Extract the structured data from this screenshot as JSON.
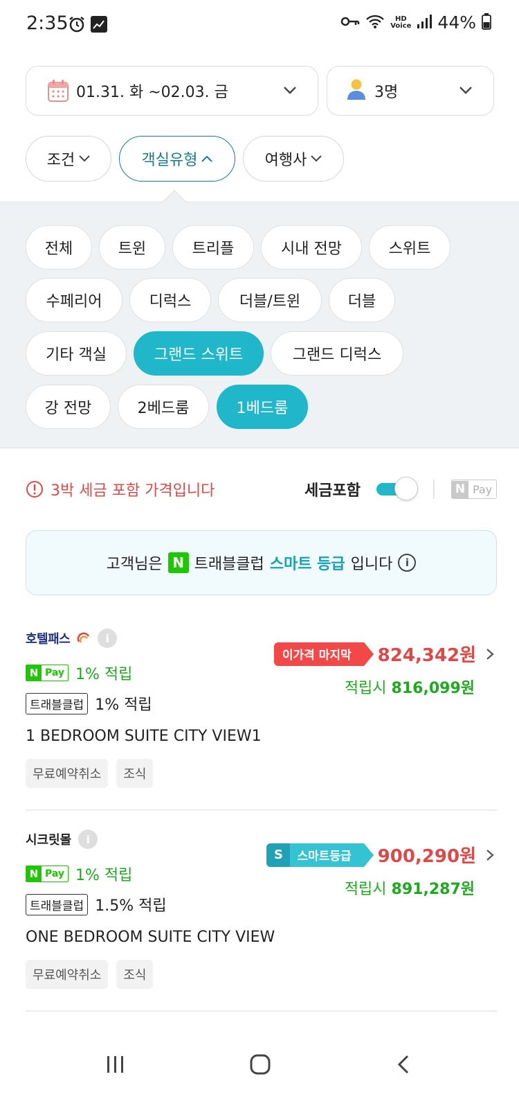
{
  "status_bar": {
    "time": "2:35",
    "battery": "44%",
    "hd_top": "HD",
    "hd_bottom": "Voice"
  },
  "search": {
    "dates": "01.31. 화 ~02.03. 금",
    "guests": "3명"
  },
  "filters": [
    {
      "label": "조건",
      "active": false
    },
    {
      "label": "객실유형",
      "active": true
    },
    {
      "label": "여행사",
      "active": false
    }
  ],
  "room_types": [
    {
      "label": "전체",
      "selected": false
    },
    {
      "label": "트윈",
      "selected": false
    },
    {
      "label": "트리플",
      "selected": false
    },
    {
      "label": "시내 전망",
      "selected": false
    },
    {
      "label": "스위트",
      "selected": false
    },
    {
      "label": "수페리어",
      "selected": false
    },
    {
      "label": "디럭스",
      "selected": false
    },
    {
      "label": "더블/트윈",
      "selected": false
    },
    {
      "label": "더블",
      "selected": false
    },
    {
      "label": "기타 객실",
      "selected": false
    },
    {
      "label": "그랜드 스위트",
      "selected": true
    },
    {
      "label": "그랜드 디럭스",
      "selected": false
    },
    {
      "label": "강 전망",
      "selected": false
    },
    {
      "label": "2베드룸",
      "selected": false
    },
    {
      "label": "1베드룸",
      "selected": true
    }
  ],
  "tax": {
    "warning": "3박 세금 포함 가격입니다",
    "toggle_label": "세금포함",
    "toggle_on": true,
    "npay_n": "N",
    "npay_label": "Pay"
  },
  "banner": {
    "prefix": "고객님은",
    "n_badge": "N",
    "club": "트래블클럽",
    "grade": "스마트 등급",
    "suffix": "입니다"
  },
  "listings": [
    {
      "vendor": "호텔패스",
      "npay_n": "N",
      "npay_label": "Pay",
      "npay_rate": "1% 적립",
      "tc_label": "트래블클럽",
      "tc_rate": "1% 적립",
      "room": "1 BEDROOM SUITE CITY VIEW1",
      "tags": [
        "무료예약취소",
        "조식"
      ],
      "badge": "이가격 마지막",
      "badge_s": "",
      "price": "824,342원",
      "reward_prefix": "적립시",
      "reward_price": "816,099원"
    },
    {
      "vendor": "시크릿몰",
      "npay_n": "N",
      "npay_label": "Pay",
      "npay_rate": "1% 적립",
      "tc_label": "트래블클럽",
      "tc_rate": "1.5% 적립",
      "room": "ONE BEDROOM SUITE CITY VIEW",
      "tags": [
        "무료예약취소",
        "조식"
      ],
      "badge": "스마트등급",
      "badge_s": "S",
      "price": "900,290원",
      "reward_prefix": "적립시",
      "reward_price": "891,287원"
    }
  ],
  "colors": {
    "teal": "#1fb7c9",
    "dark_teal": "#177e86",
    "red": "#e04848",
    "green": "#1fa91e",
    "naver_green": "#1ec800"
  }
}
